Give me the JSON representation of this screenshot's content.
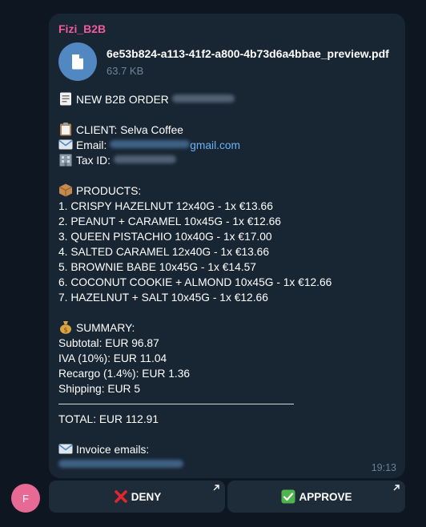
{
  "chat": {
    "sender_name": "Fizi_B2B",
    "time": "19:13",
    "avatar_letter": "F"
  },
  "file": {
    "name": "6e53b824-a113-41f2-a800-4b73d6a4bbae_preview.pdf",
    "size": "63.7 KB",
    "icon": "document-icon"
  },
  "order": {
    "title": "NEW B2B ORDER",
    "client_line": "CLIENT: Selva Coffee",
    "email_label": "Email:",
    "email_visible_suffix": "gmail.com",
    "tax_label": "Tax ID:",
    "products_heading": "PRODUCTS:",
    "products": [
      "1. CRISPY HAZELNUT 12x40G - 1x €13.66",
      "2. PEANUT + CARAMEL 10x45G - 1x €12.66",
      "3. QUEEN PISTACHIO 10x40G - 1x €17.00",
      "4. SALTED CARAMEL 12x40G - 1x €13.66",
      "5. BROWNIE BABE 10x45G - 1x €14.57",
      "6. COCONUT COOKIE + ALMOND 10x45G - 1x €12.66",
      "7. HAZELNUT + SALT 10x45G - 1x €12.66"
    ],
    "summary_heading": "SUMMARY:",
    "subtotal": "Subtotal: EUR 96.87",
    "iva": "IVA (10%): EUR 11.04",
    "recargo": "Recargo (1.4%): EUR 1.36",
    "shipping": "Shipping: EUR 5",
    "total": "TOTAL: EUR 112.91",
    "invoice_emails_label": "Invoice emails:"
  },
  "buttons": {
    "deny_label": "DENY",
    "approve_label": "APPROVE"
  },
  "colors": {
    "background": "#0e1621",
    "bubble": "#182533",
    "sender": "#ee5c99",
    "link": "#6ab3f3",
    "file_icon_bg": "#5288c1",
    "avatar": "#e66a93"
  }
}
